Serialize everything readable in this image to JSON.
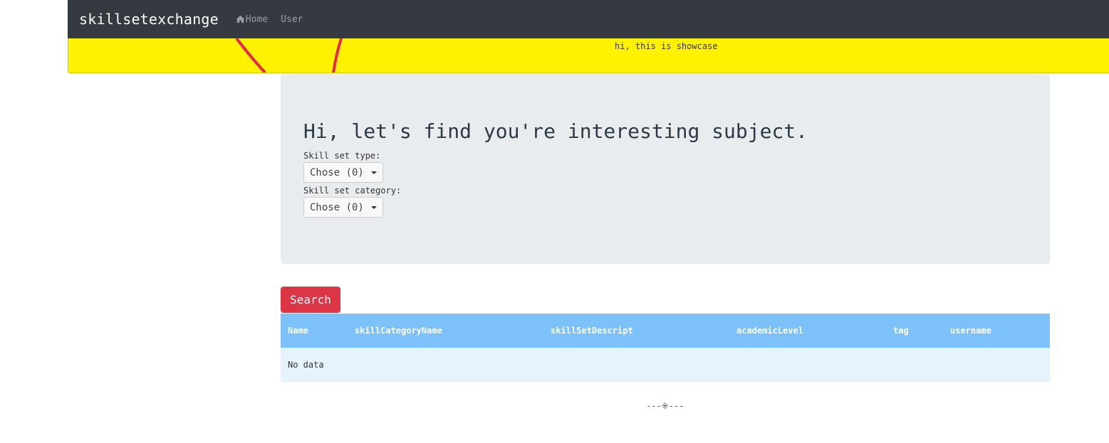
{
  "navbar": {
    "brand": "skillsetexchange",
    "links": [
      {
        "label": "Home",
        "icon": "home-icon"
      },
      {
        "label": "User"
      }
    ]
  },
  "showcase": {
    "text": "hi, this is showcase"
  },
  "jumbotron": {
    "title": "Hi, let's find you're interesting subject.",
    "skill_type_label": "Skill set type:",
    "skill_type_value": "Chose (0)",
    "skill_category_label": "Skill set category:",
    "skill_category_value": "Chose (0)"
  },
  "search_button": "Search",
  "table": {
    "headers": [
      "Name",
      "skillCategoryName",
      "skillSetDescript",
      "academicLevel",
      "tag",
      "username"
    ],
    "empty_text": "No data"
  },
  "footer": {
    "text": "---⁜---"
  },
  "colors": {
    "navbar": "#343a40",
    "showcase": "#fff200",
    "jumbotron": "#e9ecef",
    "search_button": "#dc3545",
    "table_header": "#7dc1fb",
    "table_row": "#e6f3fd"
  }
}
